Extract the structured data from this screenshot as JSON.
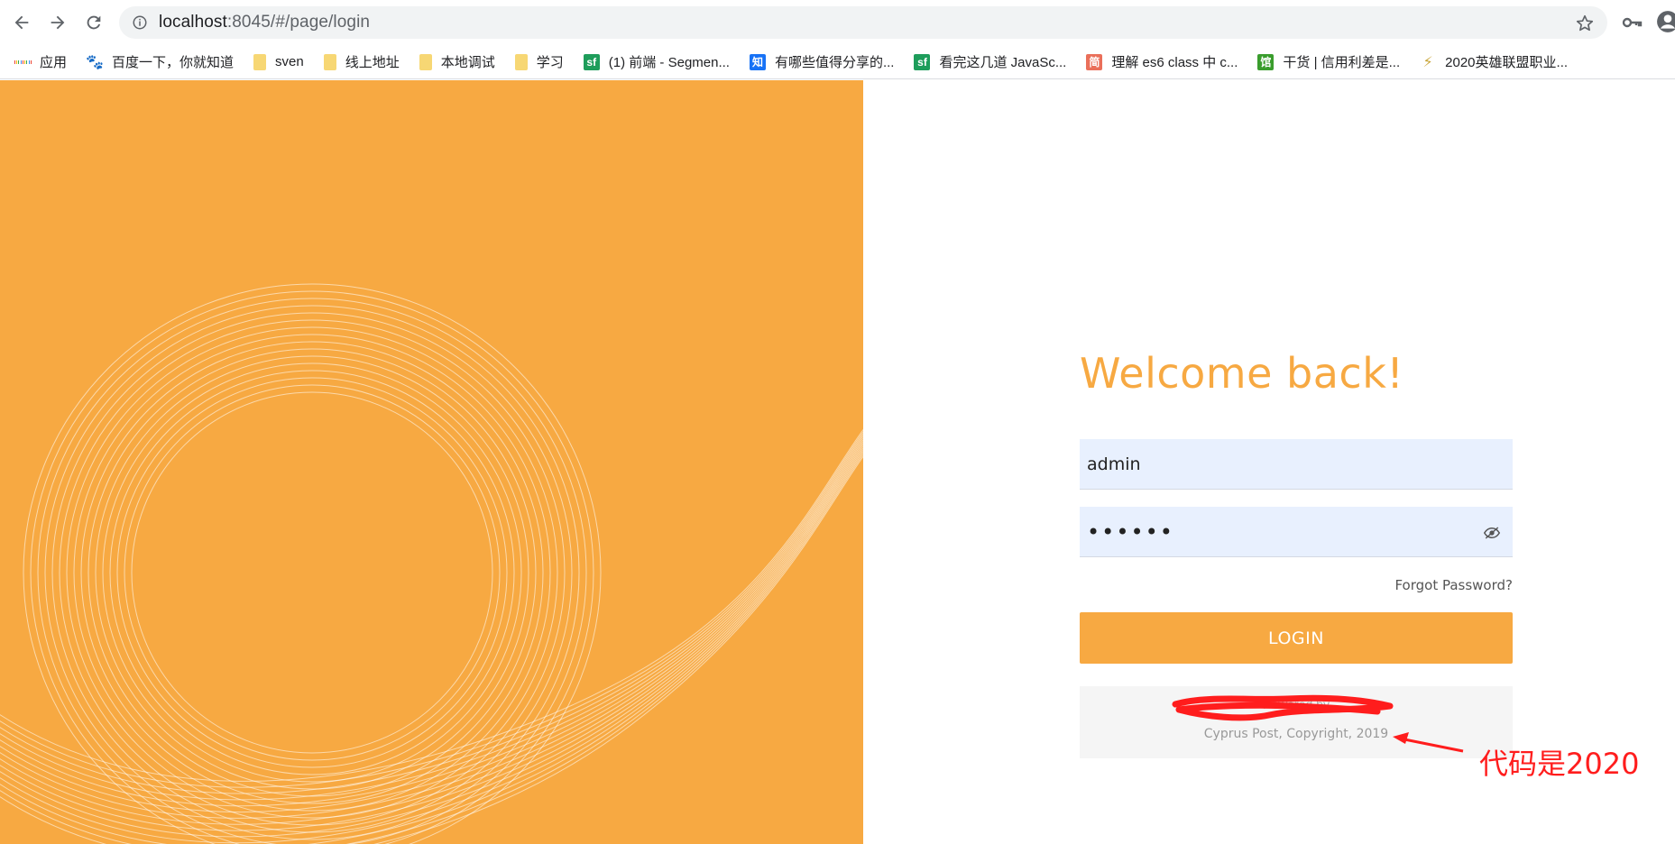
{
  "browser": {
    "url_host": "localhost",
    "url_rest": ":8045/#/page/login"
  },
  "bookmarks": [
    {
      "label": "应用",
      "icon": "apps-grid-icon"
    },
    {
      "label": "百度一下，你就知道",
      "icon": "baidu-paw-icon"
    },
    {
      "label": "sven",
      "icon": "folder-icon"
    },
    {
      "label": "线上地址",
      "icon": "folder-icon"
    },
    {
      "label": "本地调试",
      "icon": "folder-icon"
    },
    {
      "label": "学习",
      "icon": "folder-icon"
    },
    {
      "label": "(1) 前端 - Segmen...",
      "icon": "segmentfault-icon",
      "glyph": "sf"
    },
    {
      "label": "有哪些值得分享的...",
      "icon": "zhihu-icon",
      "glyph": "知"
    },
    {
      "label": "看完这几道 JavaSc...",
      "icon": "segmentfault-icon",
      "glyph": "sf"
    },
    {
      "label": "理解 es6 class 中 c...",
      "icon": "jianshu-icon",
      "glyph": "简"
    },
    {
      "label": "干货 | 信用利差是...",
      "icon": "guan-icon",
      "glyph": "馆"
    },
    {
      "label": "2020英雄联盟职业...",
      "icon": "lol-icon",
      "glyph": "⚡"
    }
  ],
  "login": {
    "title": "Welcome back!",
    "username_value": "admin",
    "password_value": "••••••",
    "forgot_label": "Forgot Password?",
    "login_label": "LOGIN",
    "powered_label": "Powered by",
    "copyright": "Cyprus Post, Copyright, 2019"
  },
  "annotation": {
    "text": "代码是2020"
  },
  "colors": {
    "brand_orange": "#f7a942",
    "input_bg": "#e8f0fe",
    "annotation_red": "#ff1d1d"
  }
}
